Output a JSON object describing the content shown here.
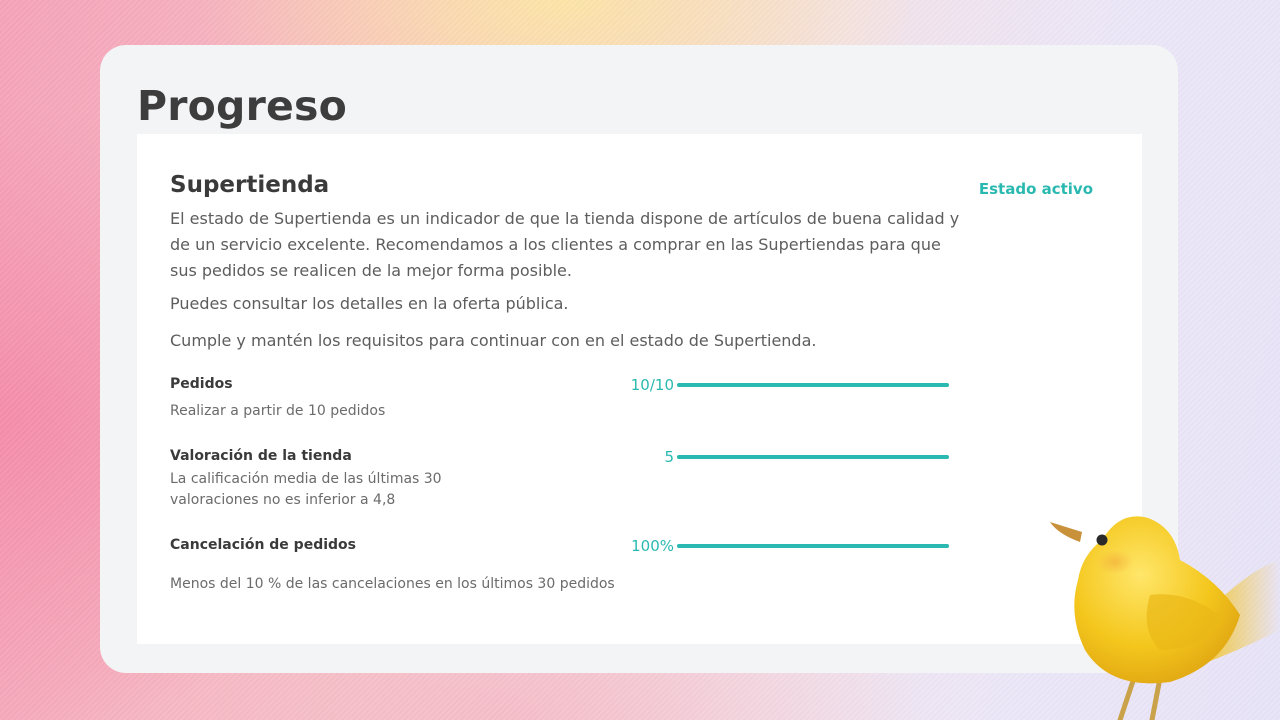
{
  "page": {
    "title": "Progreso"
  },
  "card": {
    "title": "Supertienda",
    "status": "Estado activo",
    "description": "El estado de Supertienda es un indicador de que la tienda dispone de artículos de buena calidad y de un servicio excelente. Recomendamos a los clientes a comprar en las Supertiendas para que sus pedidos se realicen de la mejor forma posible.",
    "note_offer": "Puedes consultar los detalles en la oferta pública.",
    "note_requirements": "Cumple y mantén los requisitos para continuar con en el estado de Supertienda."
  },
  "requirements": [
    {
      "title": "Pedidos",
      "description": "Realizar a partir de 10 pedidos",
      "value": "10/10",
      "progress": 1.0
    },
    {
      "title": "Valoración de la tienda",
      "description": "La calificación media de las últimas 30 valoraciones no es inferior a 4,8",
      "value": "5",
      "progress": 1.0
    },
    {
      "title": "Cancelación de pedidos",
      "description": "Menos del 10 % de las cancelaciones en los últimos 30 pedidos",
      "value": "100%",
      "progress": 1.0
    }
  ],
  "colors": {
    "accent": "#2ab9b0",
    "text_dark": "#3a3a3a",
    "text_muted": "#5d5d5d",
    "panel_bg": "#f3f4f6",
    "bird": "#f2c418"
  },
  "icons": {
    "mascot": "yellow-bird-illustration"
  }
}
